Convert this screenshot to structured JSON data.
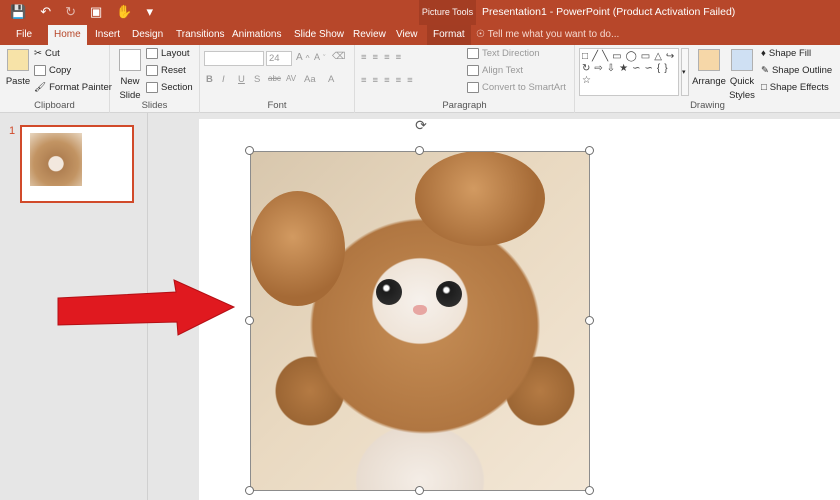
{
  "window": {
    "title": "Presentation1 - PowerPoint (Product Activation Failed)",
    "context_tab_group": "Picture Tools"
  },
  "tabs": [
    "File",
    "Home",
    "Insert",
    "Design",
    "Transitions",
    "Animations",
    "Slide Show",
    "Review",
    "View",
    "Format"
  ],
  "active_tab": "Home",
  "tell_me": "Tell me what you want to do...",
  "ribbon": {
    "clipboard": {
      "label": "Clipboard",
      "paste": "Paste",
      "cut": "Cut",
      "copy": "Copy",
      "format_painter": "Format Painter"
    },
    "slides": {
      "label": "Slides",
      "new_slide": "New",
      "new_slide2": "Slide",
      "layout": "Layout",
      "reset": "Reset",
      "section": "Section"
    },
    "font": {
      "label": "Font",
      "font_name": "",
      "font_size": "24",
      "bold": "B",
      "italic": "I",
      "underline": "U",
      "strike": "S",
      "spacing": "AV",
      "case": "Aa",
      "color": "A"
    },
    "paragraph": {
      "label": "Paragraph",
      "text_direction": "Text Direction",
      "align_text": "Align Text",
      "smartart": "Convert to SmartArt"
    },
    "drawing": {
      "label": "Drawing",
      "arrange": "Arrange",
      "quick_styles": "Quick",
      "quick_styles2": "Styles",
      "shape_fill": "Shape Fill",
      "shape_outline": "Shape Outline",
      "shape_effects": "Shape Effects"
    }
  },
  "slide_panel": {
    "slide_number": "1"
  },
  "colors": {
    "accent": "#b7472a",
    "selection": "#d14a2a",
    "arrow": "#e0191f"
  }
}
